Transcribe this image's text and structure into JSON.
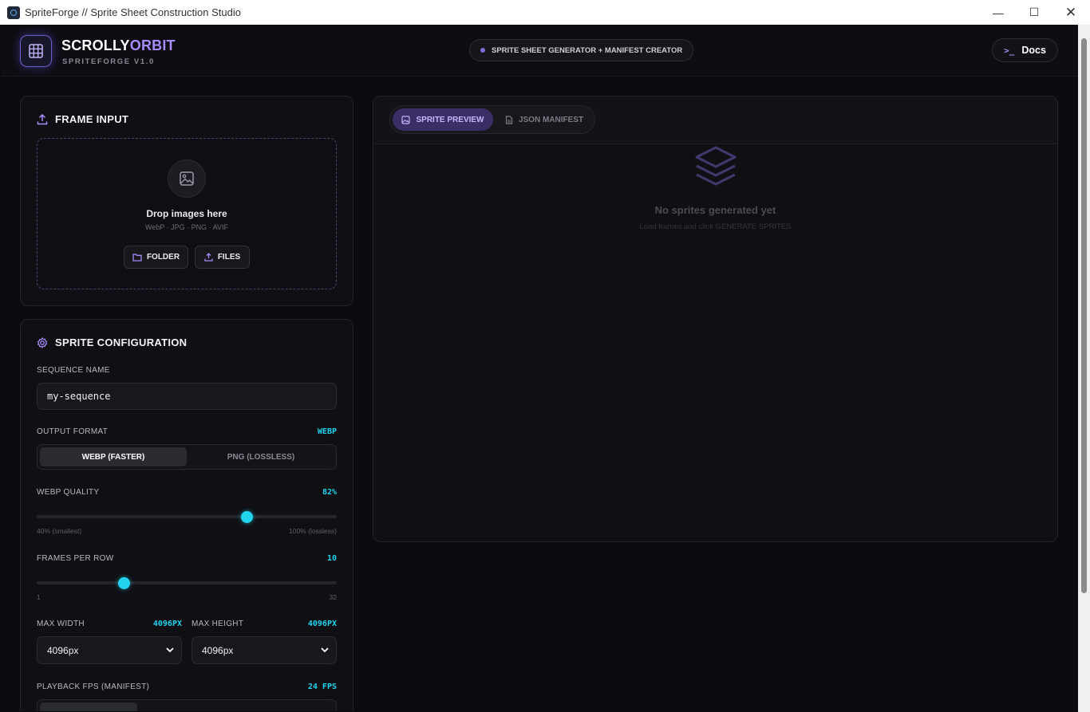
{
  "window": {
    "title": "SpriteForge  //  Sprite Sheet Construction Studio"
  },
  "header": {
    "brand_a": "SCROLLY",
    "brand_b": "ORBIT",
    "subtitle": "SPRITEFORGE V1.0",
    "pill": "SPRITE SHEET GENERATOR + MANIFEST CREATOR",
    "docs_prompt": ">_",
    "docs_label": "Docs"
  },
  "frame_input": {
    "title": "FRAME INPUT",
    "drop_heading": "Drop images here",
    "drop_formats": "WebP · JPG · PNG · AVIF",
    "folder_label": "FOLDER",
    "files_label": "FILES"
  },
  "config": {
    "title": "SPRITE CONFIGURATION",
    "sequence_label": "SEQUENCE NAME",
    "sequence_value": "my-sequence",
    "format_label": "OUTPUT FORMAT",
    "format_value": "WEBP",
    "format_options": [
      "WEBP (FASTER)",
      "PNG (LOSSLESS)"
    ],
    "quality_label": "WEBP QUALITY",
    "quality_value": "82%",
    "quality": {
      "value": 82,
      "min": 40,
      "max": 100
    },
    "quality_min_label": "40% (smallest)",
    "quality_max_label": "100% (lossless)",
    "frames_label": "FRAMES PER ROW",
    "frames_value": "10",
    "frames": {
      "value": 10,
      "min": 1,
      "max": 32
    },
    "frames_min_label": "1",
    "frames_max_label": "32",
    "max_width_label": "MAX WIDTH",
    "max_width_value": "4096PX",
    "max_width_selected": "4096px",
    "max_height_label": "MAX HEIGHT",
    "max_height_value": "4096PX",
    "max_height_selected": "4096px",
    "fps_label": "PLAYBACK FPS (MANIFEST)",
    "fps_value": "24 FPS"
  },
  "preview": {
    "tab_preview": "SPRITE PREVIEW",
    "tab_manifest": "JSON MANIFEST",
    "empty_heading": "No sprites generated yet",
    "empty_hint": "Load frames and click GENERATE SPRITES"
  },
  "colors": {
    "accent_purple": "#a78bfa",
    "accent_cyan": "#22d3ee",
    "background": "#0c0c10"
  }
}
